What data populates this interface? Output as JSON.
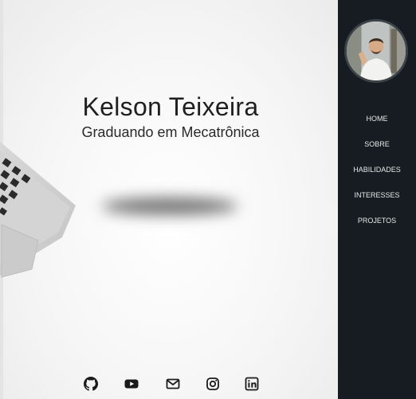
{
  "hero": {
    "name": "Kelson Teixeira",
    "subtitle": "Graduando em Mecatrônica"
  },
  "socials": [
    {
      "icon": "github-icon",
      "label": "GitHub"
    },
    {
      "icon": "youtube-icon",
      "label": "YouTube"
    },
    {
      "icon": "envelope-icon",
      "label": "Email"
    },
    {
      "icon": "instagram-icon",
      "label": "Instagram"
    },
    {
      "icon": "linkedin-icon",
      "label": "LinkedIn"
    }
  ],
  "sidebar": {
    "nav": [
      {
        "label": "HOME"
      },
      {
        "label": "SOBRE"
      },
      {
        "label": "HABILIDADES"
      },
      {
        "label": "INTERESSES"
      },
      {
        "label": "PROJETOS"
      }
    ]
  },
  "colors": {
    "sidebar_bg": "#161c21",
    "text_dark": "#1f1f1f",
    "nav_text": "#e8e8e8"
  }
}
